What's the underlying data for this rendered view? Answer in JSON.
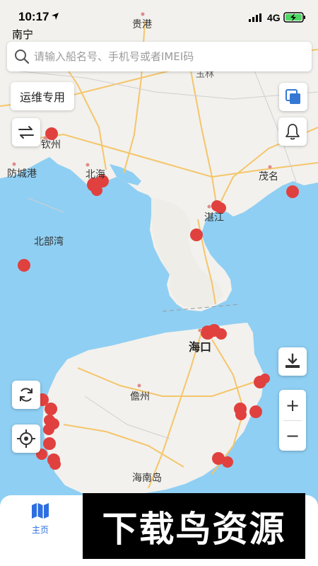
{
  "status_bar": {
    "time": "10:17",
    "city": "南宁",
    "network": "4G"
  },
  "search": {
    "placeholder": "请输入船名号、手机号或者IMEI码"
  },
  "ops_chip": {
    "label": "运维专用"
  },
  "map": {
    "labels": {
      "guigang": "贵港",
      "yulin": "玉林",
      "qinzhou": "钦州",
      "fangchenggang": "防城港",
      "beihai": "北海",
      "maoming": "茂名",
      "zhanjiang": "湛江",
      "beibuwan": "北部湾",
      "haikou": "海口",
      "danzhou": "儋州",
      "hainandao": "海南岛"
    },
    "colors": {
      "sea": "#8fcff3",
      "land": "#f2f1ed",
      "marker": "#e0413f",
      "road": "#f5c56a"
    }
  },
  "controls": {
    "zoom_in": "+",
    "zoom_out": "−"
  },
  "tabbar": {
    "home_label": "主页",
    "accent": "#2d6ee0"
  },
  "watermark": {
    "text": "下载鸟资源"
  }
}
